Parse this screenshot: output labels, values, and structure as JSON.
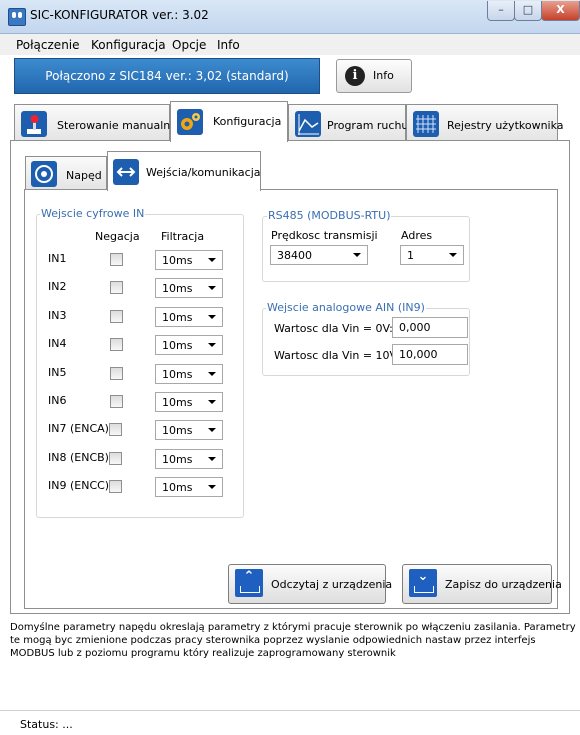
{
  "window": {
    "title": "SIC-KONFIGURATOR  ver.: 3.02",
    "minimize": "–",
    "maximize": "□",
    "close": "X"
  },
  "menu": [
    "Połączenie",
    "Konfiguracja",
    "Opcje",
    "Info"
  ],
  "connection": {
    "status": "Połączono z SIC184 ver.: 3,02  (standard)",
    "info_button": "Info"
  },
  "main_tabs": [
    {
      "label": "Sterowanie manualne",
      "icon": "joystick-icon"
    },
    {
      "label": "Konfiguracja",
      "icon": "gears-icon",
      "active": true
    },
    {
      "label": "Program ruchu",
      "icon": "motion-graph-icon"
    },
    {
      "label": "Rejestry użytkownika",
      "icon": "register-grid-icon"
    }
  ],
  "sub_tabs": [
    {
      "label": "Napęd",
      "icon": "drive-icon"
    },
    {
      "label": "Wejścia/komunikacja",
      "icon": "arrows-icon",
      "active": true
    }
  ],
  "digital_inputs": {
    "title": "Wejscie cyfrowe IN",
    "col_negation": "Negacja",
    "col_filter": "Filtracja",
    "rows": [
      {
        "label": "IN1",
        "negated": false,
        "filter": "10ms"
      },
      {
        "label": "IN2",
        "negated": false,
        "filter": "10ms"
      },
      {
        "label": "IN3",
        "negated": false,
        "filter": "10ms"
      },
      {
        "label": "IN4",
        "negated": false,
        "filter": "10ms"
      },
      {
        "label": "IN5",
        "negated": false,
        "filter": "10ms"
      },
      {
        "label": "IN6",
        "negated": false,
        "filter": "10ms"
      },
      {
        "label": "IN7 (ENCA)",
        "negated": false,
        "filter": "10ms"
      },
      {
        "label": "IN8 (ENCB)",
        "negated": false,
        "filter": "10ms"
      },
      {
        "label": "IN9 (ENCC)",
        "negated": false,
        "filter": "10ms"
      }
    ]
  },
  "rs485": {
    "title": "RS485 (MODBUS-RTU)",
    "speed_label": "Prędkosc transmisji",
    "speed_value": "38400",
    "address_label": "Adres",
    "address_value": "1"
  },
  "analog": {
    "title": "Wejscie analogowe AIN (IN9)",
    "v0_label": "Wartosc dla Vin = 0V:",
    "v0_value": "0,000",
    "v10_label": "Wartosc dla Vin = 10V:",
    "v10_value": "10,000"
  },
  "buttons": {
    "read": "Odczytaj z urządzenia",
    "write": "Zapisz do urządzenia"
  },
  "description": "Domyślne parametry napędu okreslają parametry z którymi pracuje sterownik po włączeniu zasilania. Parametry te mogą byc zmienione podczas pracy sterownika poprzez wyslanie odpowiednich nastaw przez interfejs MODBUS lub z poziomu programu który realizuje zaprogramowany sterownik",
  "status": "Status: ..."
}
